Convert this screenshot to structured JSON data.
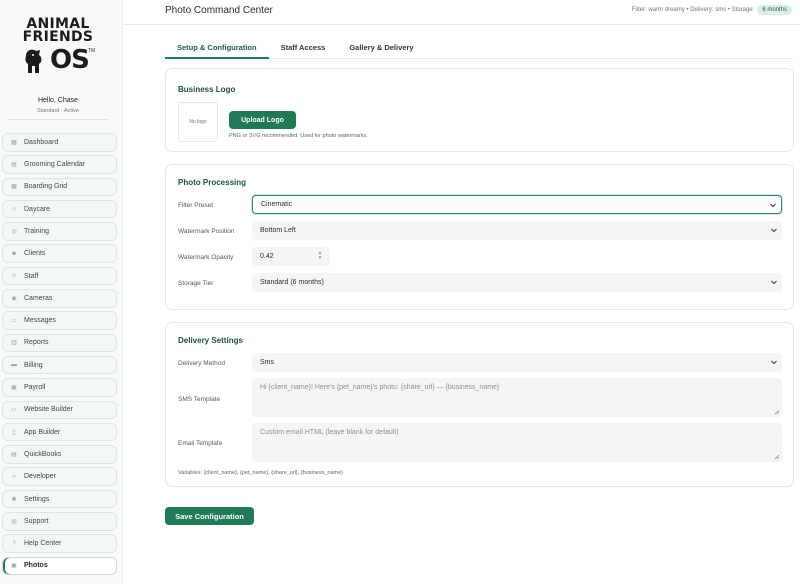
{
  "brand": {
    "line1": "ANIMAL",
    "line2": "FRIENDS",
    "os": "OS",
    "tm": "TM"
  },
  "user": {
    "greeting": "Hello, Chase",
    "plan": "Standard · Active"
  },
  "nav": {
    "items": [
      {
        "label": "Dashboard",
        "icon": "grid-icon"
      },
      {
        "label": "Grooming Calendar",
        "icon": "calendar-icon"
      },
      {
        "label": "Boarding Grid",
        "icon": "grid-icon"
      },
      {
        "label": "Daycare",
        "icon": "sun-icon"
      },
      {
        "label": "Training",
        "icon": "target-icon"
      },
      {
        "label": "Clients",
        "icon": "users-icon"
      },
      {
        "label": "Staff",
        "icon": "person-icon"
      },
      {
        "label": "Cameras",
        "icon": "camera-icon"
      },
      {
        "label": "Messages",
        "icon": "chat-icon"
      },
      {
        "label": "Reports",
        "icon": "chart-icon"
      },
      {
        "label": "Billing",
        "icon": "card-icon"
      },
      {
        "label": "Payroll",
        "icon": "wallet-icon"
      },
      {
        "label": "Website Builder",
        "icon": "browser-icon"
      },
      {
        "label": "App Builder",
        "icon": "phone-icon"
      },
      {
        "label": "QuickBooks",
        "icon": "book-icon"
      },
      {
        "label": "Developer",
        "icon": "code-icon"
      },
      {
        "label": "Settings",
        "icon": "gear-icon"
      },
      {
        "label": "Support",
        "icon": "lifebuoy-icon"
      },
      {
        "label": "Help Center",
        "icon": "help-icon"
      },
      {
        "label": "Photos",
        "icon": "photo-icon",
        "active": true
      }
    ]
  },
  "header": {
    "title": "Photo Command Center",
    "status_text": "Filter: warm dreamy • Delivery: sms • Storage:",
    "storage_badge": "6 months"
  },
  "tabs": [
    {
      "label": "Setup & Configuration",
      "active": true
    },
    {
      "label": "Staff Access"
    },
    {
      "label": "Gallery & Delivery"
    }
  ],
  "business_logo": {
    "title": "Business Logo",
    "placeholder": "No logo",
    "upload_label": "Upload Logo",
    "hint": "PNG or SVG recommended. Used for photo watermarks."
  },
  "photo_processing": {
    "title": "Photo Processing",
    "filter_label": "Filter Preset",
    "filter_value": "Cinematic",
    "watermark_position_label": "Watermark Position",
    "watermark_position_value": "Bottom Left",
    "watermark_opacity_label": "Watermark Opacity",
    "watermark_opacity_value": "0.42",
    "storage_tier_label": "Storage Tier",
    "storage_tier_value": "Standard (6 months)"
  },
  "delivery": {
    "title": "Delivery Settings",
    "method_label": "Delivery Method",
    "method_value": "Sms",
    "sms_label": "SMS Template",
    "sms_placeholder": "Hi {client_name}! Here's {pet_name}'s photo: {share_url} — {business_name}",
    "email_label": "Email Template",
    "email_placeholder": "Custom email HTML (leave blank for default)",
    "variables": "Variables: {client_name}, {pet_name}, {share_url}, {business_name}"
  },
  "save_label": "Save Configuration",
  "colors": {
    "accent": "#1f7a55",
    "sidebar_bg": "#f7faf8",
    "heading": "#1f4f39"
  }
}
